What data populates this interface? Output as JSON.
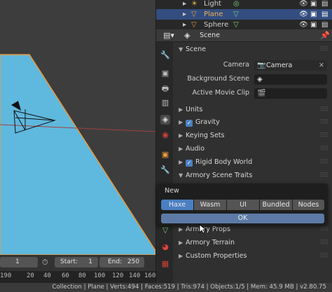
{
  "outliner": {
    "rows": [
      {
        "label": "Light"
      },
      {
        "label": "Plane"
      },
      {
        "label": "Sphere"
      }
    ]
  },
  "properties": {
    "header_title": "Scene",
    "section_scene": "Scene",
    "camera_label": "Camera",
    "camera_value": "Camera",
    "background_label": "Background Scene",
    "movie_clip_label": "Active Movie Clip",
    "panels": {
      "units": "Units",
      "gravity": "Gravity",
      "keying_sets": "Keying Sets",
      "audio": "Audio",
      "rigid_body": "Rigid Body World",
      "armory_traits": "Armory Scene Traits",
      "armory_props": "Armory Props",
      "armory_terrain": "Armory Terrain",
      "custom_props": "Custom Properties"
    }
  },
  "popup": {
    "title": "New",
    "options": [
      "Haxe",
      "Wasm",
      "UI",
      "Bundled",
      "Nodes"
    ],
    "selected": "Haxe",
    "ok_label": "OK"
  },
  "timeline": {
    "current_frame": "1",
    "start_label": "Start:",
    "start_value": "1",
    "end_label": "End:",
    "end_value": "250",
    "ruler": [
      "190",
      "20",
      "40",
      "60",
      "80",
      "100",
      "120",
      "140",
      "160"
    ]
  },
  "statusbar": {
    "text": "Collection | Plane | Verts:494 | Faces:519 | Tris:974 | Objects:1/5 | Mem: 45.9 MB | v2.80.75"
  },
  "colors": {
    "plane_fill": "#5fb8de",
    "plane_edge": "#e89a3c",
    "selected_row": "#334d80",
    "accent": "#4a7fc1"
  }
}
